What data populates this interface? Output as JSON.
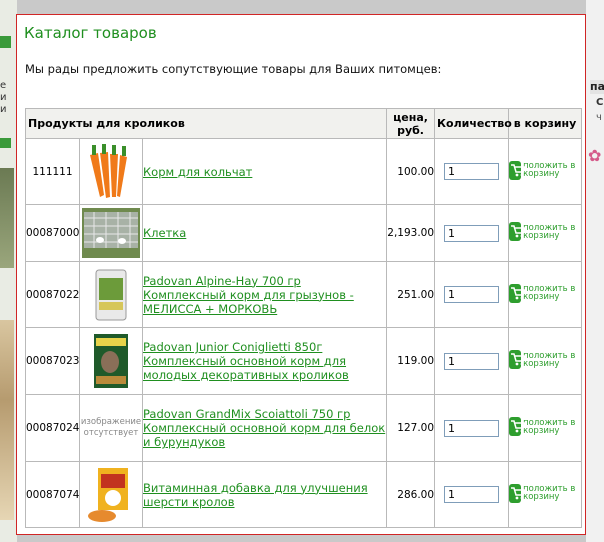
{
  "background": {
    "left_text": "е\nи\nи",
    "right_header": "па",
    "right_text1": "Сп",
    "right_text2": "ч"
  },
  "dialog": {
    "title": "Каталог товаров",
    "intro": "Мы рады предложить сопутствующие товары для Ваших питомцев:",
    "border_color": "#d02525",
    "accent_color": "#1f8f1f"
  },
  "table": {
    "headers": {
      "products": "Продукты для кроликов",
      "price": "цена,\nруб.",
      "quantity": "Количество",
      "to_cart": "в корзину"
    },
    "cart_button_label": "положить в корзину",
    "no_image_label": "изображение отсутствует",
    "rows": [
      {
        "code": "111111",
        "image": "carrots-image",
        "name": "Корм для кольчат",
        "price": "100.00",
        "qty": "1"
      },
      {
        "code": "00087000",
        "image": "rabbit-cage-image",
        "name": "Клетка",
        "price": "2,193.00",
        "qty": "1"
      },
      {
        "code": "00087022",
        "image": "feed-bag-image",
        "name": "Padovan Alpine-Hay 700 гр Комплексный корм для грызунов - МЕЛИССА + МОРКОВЬ",
        "price": "251.00",
        "qty": "1"
      },
      {
        "code": "00087023",
        "image": "rabbit-feed-box-image",
        "name": "Padovan Junior Coniglietti 850г Комплексный основной корм для молодых декоративных кроликов",
        "price": "119.00",
        "qty": "1"
      },
      {
        "code": "00087024",
        "image": "no-image",
        "name": "Padovan GrandMix Scoiattoli 750 гр Комплексный основной корм для белок и бурундуков",
        "price": "127.00",
        "qty": "1"
      },
      {
        "code": "00087074",
        "image": "vitamin-pack-image",
        "name": "Витаминная добавка для улучшения шерсти кролов",
        "price": "286.00",
        "qty": "1"
      }
    ]
  }
}
